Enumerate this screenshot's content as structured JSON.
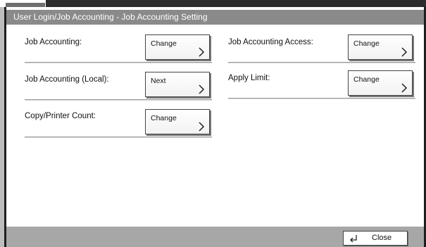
{
  "title": "User Login/Job Accounting - Job Accounting Setting",
  "rows": [
    {
      "label": "Job Accounting:",
      "button": "Change"
    },
    {
      "label": "Job Accounting (Local):",
      "button": "Next"
    },
    {
      "label": "Copy/Printer Count:",
      "button": "Change"
    },
    {
      "label": "Job Accounting Access:",
      "button": "Change"
    },
    {
      "label": "Apply Limit:",
      "button": "Change"
    }
  ],
  "footer": {
    "close_label": "Close",
    "close_icon": "return-arrow-icon"
  },
  "colors": {
    "title_bar": "#8a8a8a",
    "footer_bar": "#a7a7a7"
  }
}
